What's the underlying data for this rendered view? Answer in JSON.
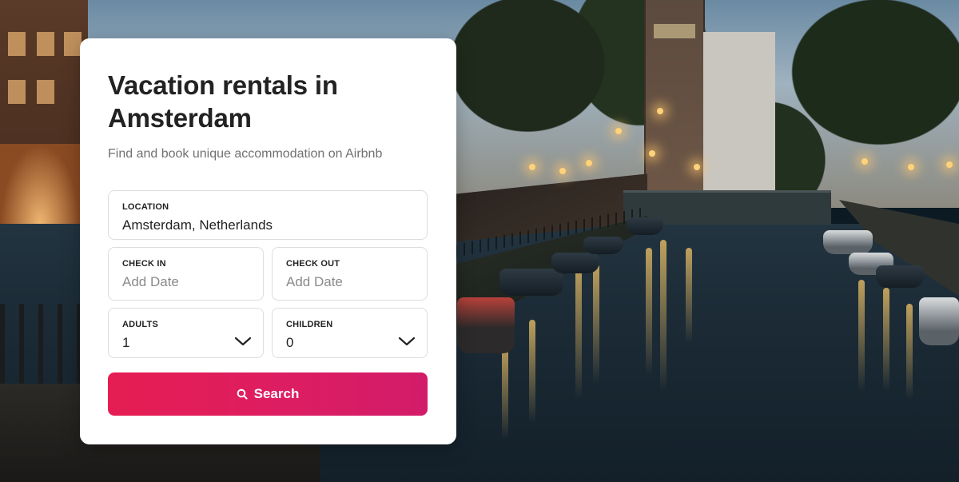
{
  "hero": {
    "title": "Vacation rentals in Amsterdam",
    "subtitle": "Find and book unique accommodation on Airbnb"
  },
  "form": {
    "location": {
      "label": "LOCATION",
      "value": "Amsterdam, Netherlands"
    },
    "check_in": {
      "label": "CHECK IN",
      "placeholder": "Add Date"
    },
    "check_out": {
      "label": "CHECK OUT",
      "placeholder": "Add Date"
    },
    "adults": {
      "label": "ADULTS",
      "value": "1"
    },
    "children": {
      "label": "CHILDREN",
      "value": "0"
    },
    "search_button": {
      "label": "Search",
      "icon": "search-icon"
    }
  },
  "colors": {
    "accent": "#e51d52",
    "accent_end": "#d21c6a",
    "title_text": "#222222",
    "subtitle_text": "#717171",
    "border": "#dddddd"
  },
  "background": {
    "scene": "amsterdam-canal-night-photo"
  }
}
